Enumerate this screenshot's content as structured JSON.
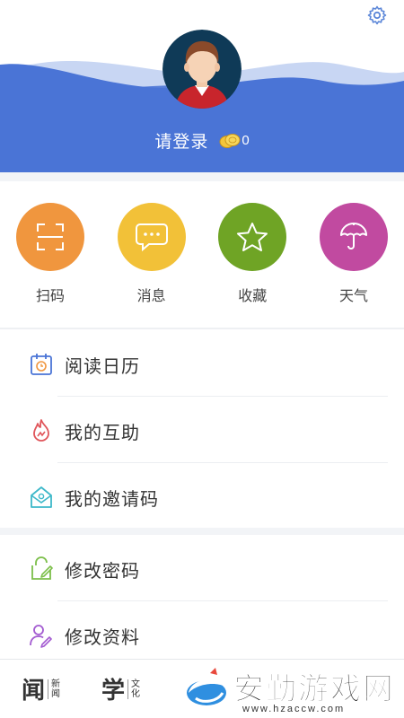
{
  "header": {
    "settings_icon": "gear-icon",
    "login_text": "请登录",
    "coin_icon": "coins-icon",
    "coin_count": "0",
    "colors": {
      "wave_dark": "#4a74d6",
      "wave_light": "#c8d6f3",
      "text": "#ffffff"
    }
  },
  "quick_actions": [
    {
      "label": "扫码",
      "icon": "scan-icon",
      "color": "#f0963e"
    },
    {
      "label": "消息",
      "icon": "message-icon",
      "color": "#f2c138"
    },
    {
      "label": "收藏",
      "icon": "star-icon",
      "color": "#6fa425"
    },
    {
      "label": "天气",
      "icon": "umbrella-icon",
      "color": "#c14aa0"
    }
  ],
  "menu_group_1": [
    {
      "label": "阅读日历",
      "icon": "calendar-icon"
    },
    {
      "label": "我的互助",
      "icon": "flame-icon"
    },
    {
      "label": "我的邀请码",
      "icon": "invite-icon"
    }
  ],
  "menu_group_2": [
    {
      "label": "修改密码",
      "icon": "edit-password-icon"
    },
    {
      "label": "修改资料",
      "icon": "edit-profile-icon"
    }
  ],
  "bottom_nav": {
    "news": {
      "big": "闻",
      "small_1": "新",
      "small_2": "闻"
    },
    "study": {
      "big": "学",
      "small_1": "文",
      "small_2": "化"
    }
  },
  "watermark": {
    "title": "安勤游戏网",
    "url": "www.hzaccw.com"
  }
}
